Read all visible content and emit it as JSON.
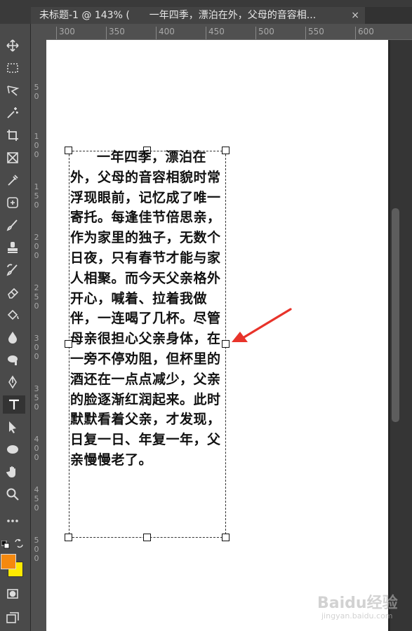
{
  "tab": {
    "title": "未标题-1 @ 143% (　　一年四季，漂泊在外，父母的音容相...",
    "close": "×"
  },
  "ruler": {
    "h_labels": [
      "300",
      "350",
      "400",
      "450",
      "500",
      "550",
      "600"
    ],
    "v_labels": [
      "5\n0",
      "1\n0\n0",
      "1\n5\n0",
      "2\n0\n0",
      "2\n5\n0",
      "3\n0\n0",
      "3\n5\n0",
      "4\n0\n0",
      "4\n5\n0",
      "5\n0\n0"
    ]
  },
  "document": {
    "text": "一年四季，漂泊在外，父母的音容相貌时常浮现眼前，记忆成了唯一寄托。每逢佳节倍思亲，作为家里的独子，无数个日夜，只有春节才能与家人相聚。而今天父亲格外开心，喊着、拉着我做伴，一连喝了几杯。尽管母亲很担心父亲身体，在一旁不停劝阻，但杯里的酒还在一点点减少，父亲的脸逐渐红润起来。此时默默看着父亲，才发现，日复一日、年复一年，父亲慢慢老了。"
  },
  "tools": [
    "move-icon",
    "marquee-icon",
    "lasso-icon",
    "magic-wand-icon",
    "crop-icon",
    "frame-icon",
    "eyedropper-icon",
    "healing-brush-icon",
    "brush-icon",
    "clone-stamp-icon",
    "history-brush-icon",
    "eraser-icon",
    "paint-bucket-icon",
    "blur-icon",
    "dodge-icon",
    "pen-icon",
    "type-icon",
    "path-selection-icon",
    "ellipse-icon",
    "hand-icon",
    "zoom-icon",
    "more-icon"
  ],
  "colors": {
    "foreground": "#f5890f",
    "background": "#ffea00",
    "arrow": "#e8332a"
  },
  "watermark": {
    "logo": "Baidu经验",
    "url": "jingyan.baidu.com"
  }
}
